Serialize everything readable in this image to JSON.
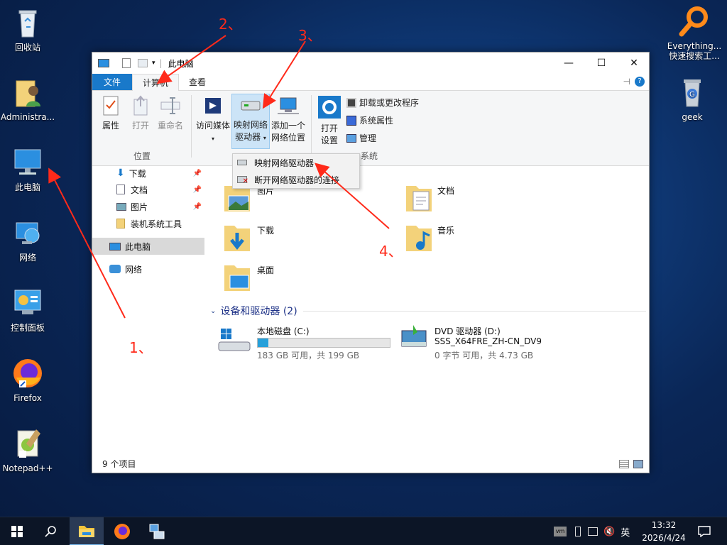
{
  "desktop": {
    "icons": [
      {
        "label": "回收站"
      },
      {
        "label": "Administra..."
      },
      {
        "label": "此电脑"
      },
      {
        "label": "网络"
      },
      {
        "label": "控制面板"
      },
      {
        "label": "Firefox"
      },
      {
        "label": "Notepad++"
      },
      {
        "label": "Everything..."
      },
      {
        "label": "快速搜索工..."
      },
      {
        "label": "geek"
      }
    ]
  },
  "window": {
    "title": "此电脑",
    "controls": {
      "minimize": "—",
      "maximize": "☐",
      "close": "✕"
    },
    "tabs": {
      "file": "文件",
      "computer": "计算机",
      "view": "查看"
    },
    "ribbon": {
      "properties": "属性",
      "open": "打开",
      "rename": "重命名",
      "location_group": "位置",
      "access_media": "访问媒体",
      "map_drive_line1": "映射网络",
      "map_drive_line2": "驱动器",
      "add_location_line1": "添加一个",
      "add_location_line2": "网络位置",
      "open_settings_line1": "打开",
      "open_settings_line2": "设置",
      "uninstall": "卸载或更改程序",
      "sys_props": "系统属性",
      "manage": "管理",
      "system_group": "系统"
    },
    "dropdown": {
      "map_item": "映射网络驱动器",
      "disconnect_item": "断开网络驱动器的连接"
    },
    "nav": {
      "downloads": "下载",
      "documents": "文档",
      "pictures": "图片",
      "tools": "装机系统工具",
      "this_pc": "此电脑",
      "network": "网络"
    },
    "folders": {
      "pictures": "图片",
      "documents": "文档",
      "downloads": "下载",
      "music": "音乐",
      "desktop": "桌面"
    },
    "devices_header": "设备和驱动器 (2)",
    "drives": {
      "c_name": "本地磁盘 (C:)",
      "c_free": "183 GB 可用，共 199 GB",
      "c_used_fraction": 0.08,
      "d_name": "DVD 驱动器 (D:)",
      "d_label": "SSS_X64FRE_ZH-CN_DV9",
      "d_free": "0 字节 可用，共 4.73 GB"
    },
    "status": "9 个项目"
  },
  "annotations": {
    "a1": "1、",
    "a2": "2、",
    "a3": "3、",
    "a4": "4、"
  },
  "taskbar": {
    "ime": "英",
    "time": "13:32",
    "date": "2026/4/24"
  },
  "colors": {
    "accent": "#1979ca",
    "annotation": "#ff2a1a",
    "taskbar": "#0c1526"
  }
}
